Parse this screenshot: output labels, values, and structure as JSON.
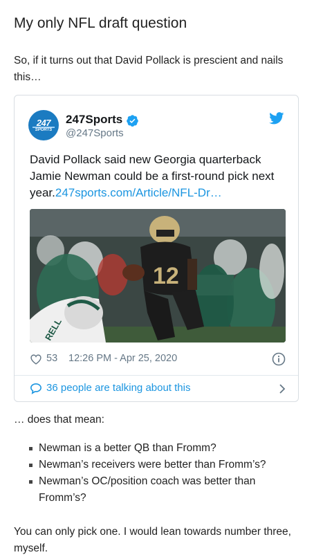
{
  "post": {
    "title": "My only NFL draft question",
    "intro": "So, if it turns out that David Pollack is prescient and nails this…",
    "question": "… does that mean:",
    "options": [
      "Newman is a better QB than Fromm?",
      "Newman’s receivers were better than Fromm’s?",
      "Newman’s OC/position coach was better than Fromm’s?"
    ],
    "closing": "You can only pick one.  I would lean towards number three, myself."
  },
  "tweet": {
    "avatar_text": "247",
    "avatar_subtext": "SPORTS",
    "account_name": "247Sports",
    "handle": "@247Sports",
    "text": "David Pollack said new Georgia quarterback Jamie Newman could be a first-round pick next year.",
    "link": "247sports.com/Article/NFL-Dr…",
    "photo": {
      "jersey_number": "12",
      "opponent_jersey_text": "RELL"
    },
    "likes": "53",
    "timestamp": "12:26 PM - Apr 25, 2020",
    "talking": "36 people are talking about this"
  },
  "colors": {
    "twitter_blue": "#1b95e0",
    "verified_blue": "#1da1f2",
    "avatar_blue": "#1b7bc1",
    "meta_gray": "#657786"
  },
  "icons": [
    "verified-badge-icon",
    "twitter-bird-icon",
    "heart-icon",
    "info-icon",
    "speech-bubble-icon",
    "chevron-right-icon"
  ]
}
